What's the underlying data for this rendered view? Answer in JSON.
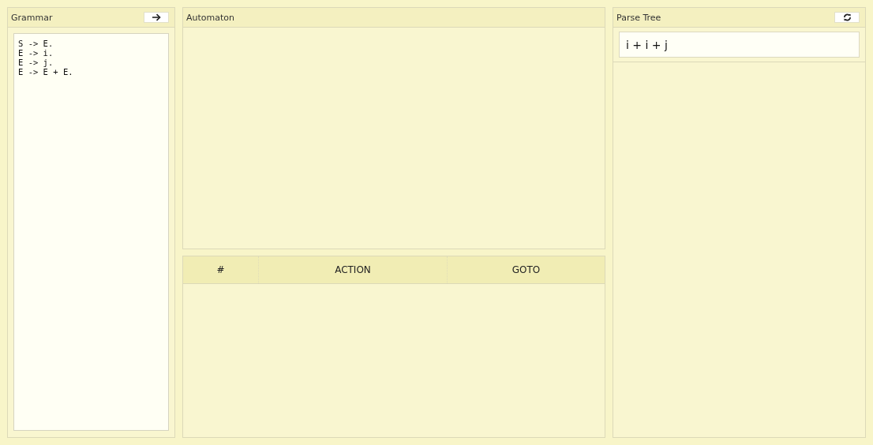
{
  "grammar": {
    "title": "Grammar",
    "editor_lines": [
      "S -> E.",
      "E -> i.",
      "E -> j.",
      "E -> E + E."
    ]
  },
  "automaton": {
    "title": "Automaton"
  },
  "table": {
    "columns": [
      "#",
      "ACTION",
      "GOTO"
    ]
  },
  "parse_tree": {
    "title": "Parse Tree",
    "input": "i + i + j"
  }
}
